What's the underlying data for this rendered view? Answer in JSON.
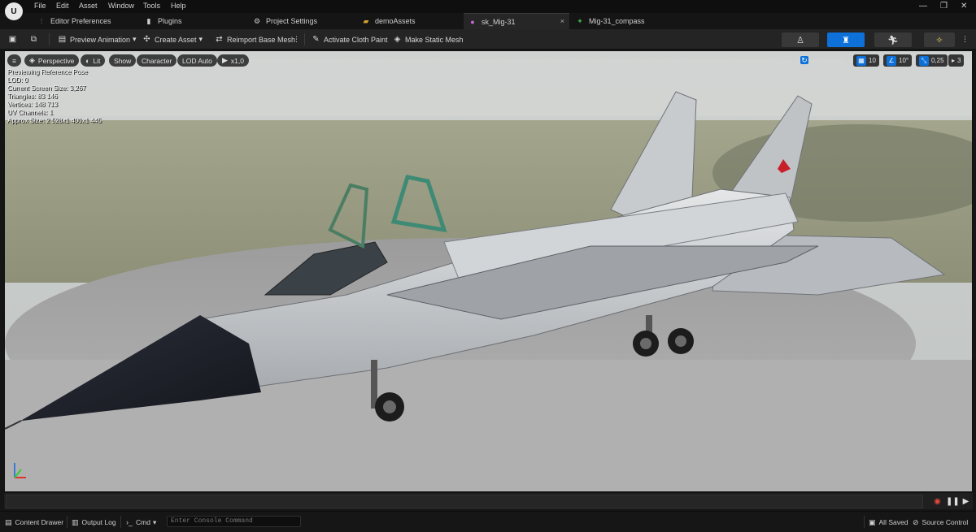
{
  "menu": {
    "items": [
      "File",
      "Edit",
      "Asset",
      "Window",
      "Tools",
      "Help"
    ]
  },
  "window_controls": {
    "minimize": "—",
    "restore": "❐",
    "close": "✕"
  },
  "tabs": [
    {
      "label": "Editor Preferences",
      "icon": "sliders-icon"
    },
    {
      "label": "Plugins",
      "icon": "plug-icon"
    },
    {
      "label": "Project Settings",
      "icon": "gear-icon"
    },
    {
      "label": "demoAssets",
      "icon": "folder-icon"
    },
    {
      "label": "sk_Mig-31",
      "icon": "skeletal-mesh-icon",
      "close": "×"
    },
    {
      "label": "Mig-31_compass",
      "icon": "skeleton-icon"
    }
  ],
  "toolbar": {
    "preview_animation": "Preview Animation",
    "create_asset": "Create Asset",
    "reimport": "Reimport Base Mesh",
    "cloth_paint": "Activate Cloth Paint",
    "static_mesh": "Make Static Mesh"
  },
  "viewport": {
    "perspective": "Perspective",
    "lit": "Lit",
    "show": "Show",
    "character": "Character",
    "lod": "LOD Auto",
    "speed": "x1,0",
    "stats": [
      "Previewing Reference Pose",
      "LOD: 0",
      "Current Screen Size: 3,267",
      "Triangles: 83 146",
      "Vertices: 148 713",
      "UV Channels: 1",
      "Approx Size: 2 528x1 400x1 445"
    ],
    "grid_snap": "10",
    "rot_snap": "10°",
    "scale_snap": "0,25",
    "camera_speed": "3"
  },
  "statusbar": {
    "content_drawer": "Content Drawer",
    "output_log": "Output Log",
    "cmd": "Cmd",
    "console_placeholder": "Enter Console Command",
    "all_saved": "All Saved",
    "source_control": "Source Control"
  },
  "colors": {
    "accent": "#0e70d9",
    "star": "#c8202a"
  }
}
